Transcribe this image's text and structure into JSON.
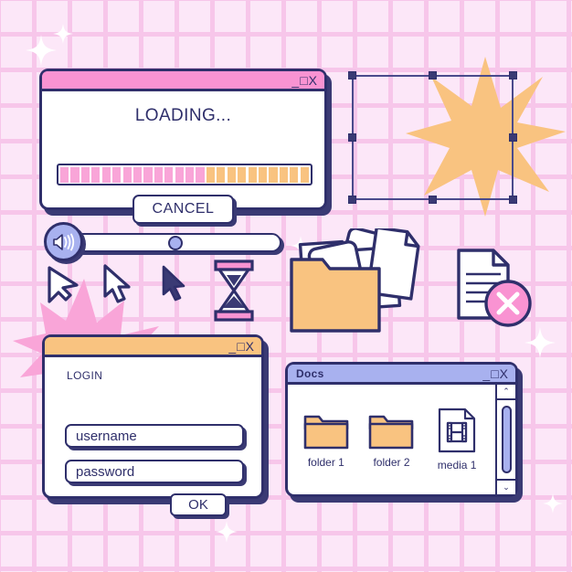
{
  "theme": {
    "background": "#fce7f8",
    "grid_line": "#f7c6ea",
    "ink": "#2f2f6b",
    "shadow": "#3a3a74",
    "pink": "#f993d2",
    "pink_light": "#f9a5d8",
    "orange": "#f9c380",
    "periwinkle": "#a8b1ef",
    "white": "#ffffff"
  },
  "loading_window": {
    "title": "",
    "controls": "_□X",
    "titlebar_color": "#f993d2",
    "status_label": "LOADING...",
    "progress": {
      "total_segments": 24,
      "filled_segments": 14,
      "percent": 58,
      "filled_color": "#f9a5d8",
      "empty_color": "#f9c380"
    },
    "cancel_label": "CANCEL"
  },
  "login_window": {
    "title": "",
    "controls": "_□X",
    "titlebar_color": "#f9c380",
    "heading": "LOGIN",
    "username_value": "username",
    "password_value": "password",
    "submit_label": "OK"
  },
  "docs_window": {
    "title": "Docs",
    "controls": "_□X",
    "titlebar_color": "#a8b1ef",
    "files": [
      {
        "label": "folder 1",
        "icon": "folder-icon",
        "type": "folder"
      },
      {
        "label": "folder 2",
        "icon": "folder-icon",
        "type": "folder"
      },
      {
        "label": "media 1",
        "icon": "film-strip-icon",
        "type": "media"
      }
    ],
    "scrollbar": {
      "up_glyph": "⌃",
      "down_glyph": "⌄"
    }
  },
  "volume_slider": {
    "icon": "speaker-icon",
    "value_percent": 50
  },
  "icons": {
    "cursor_1": "arrow-cursor-icon",
    "cursor_2": "arrow-cursor-icon",
    "cursor_3": "arrow-cursor-filled-icon",
    "hourglass": "hourglass-icon",
    "star": "eight-point-star-icon",
    "starburst": "pink-starburst-icon",
    "folder_papers": "folder-with-documents-icon",
    "document_error": "document-error-icon",
    "selection_box": "selection-handles"
  },
  "selection_box": {
    "handle_count": 8
  },
  "sparkles": {
    "count": 6,
    "color": "#ffffff"
  }
}
